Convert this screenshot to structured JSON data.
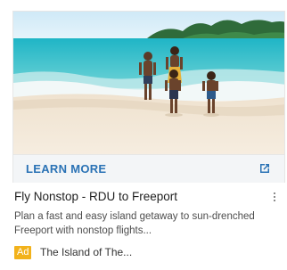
{
  "ad": {
    "cta_label": "LEARN MORE",
    "headline": "Fly Nonstop - RDU to Freeport",
    "description": "Plan a fast and easy island getaway to sun-drenched Freeport with nonstop flights...",
    "badge": "Ad",
    "advertiser": "The Island of The...",
    "image_icon": "beach-family-photo",
    "cta_icon": "open-in-new-icon",
    "menu_icon": "more-vert-icon"
  },
  "colors": {
    "cta_text": "#2a72b5",
    "cta_background": "#f3f5f7",
    "badge_background": "#f2b21b",
    "headline": "#1f1f1f",
    "description": "#4d4d4d"
  }
}
